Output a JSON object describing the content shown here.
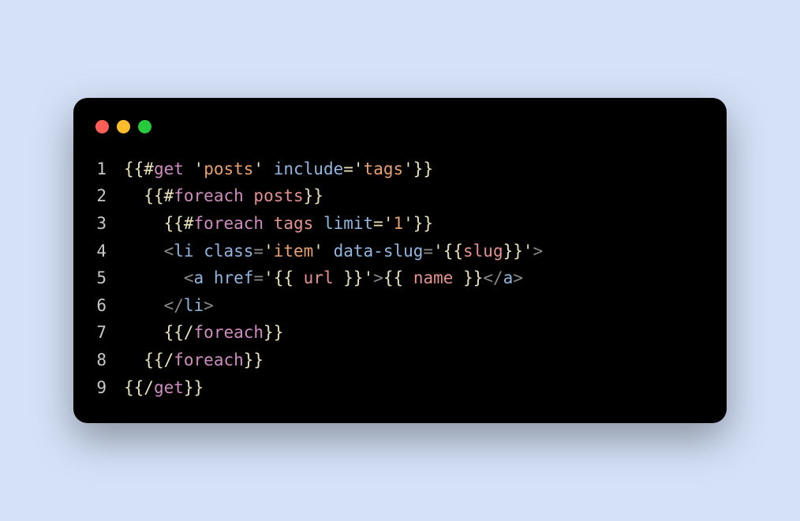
{
  "window": {
    "traffic_lights": [
      "close",
      "minimize",
      "maximize"
    ]
  },
  "code": {
    "lines": [
      {
        "num": "1",
        "indent": 0,
        "tokens": [
          {
            "c": "t-brace",
            "t": "{{"
          },
          {
            "c": "t-brace",
            "t": "#"
          },
          {
            "c": "t-helper",
            "t": "get"
          },
          {
            "c": "t-plain",
            "t": " "
          },
          {
            "c": "t-quote",
            "t": "'"
          },
          {
            "c": "t-string",
            "t": "posts"
          },
          {
            "c": "t-quote",
            "t": "'"
          },
          {
            "c": "t-plain",
            "t": " "
          },
          {
            "c": "t-attr",
            "t": "include"
          },
          {
            "c": "t-brace",
            "t": "="
          },
          {
            "c": "t-quote",
            "t": "'"
          },
          {
            "c": "t-string",
            "t": "tags"
          },
          {
            "c": "t-quote",
            "t": "'"
          },
          {
            "c": "t-brace",
            "t": "}}"
          }
        ]
      },
      {
        "num": "2",
        "indent": 1,
        "tokens": [
          {
            "c": "t-brace",
            "t": "{{"
          },
          {
            "c": "t-brace",
            "t": "#"
          },
          {
            "c": "t-helper",
            "t": "foreach"
          },
          {
            "c": "t-plain",
            "t": " "
          },
          {
            "c": "t-var",
            "t": "posts"
          },
          {
            "c": "t-brace",
            "t": "}}"
          }
        ]
      },
      {
        "num": "3",
        "indent": 2,
        "tokens": [
          {
            "c": "t-brace",
            "t": "{{"
          },
          {
            "c": "t-brace",
            "t": "#"
          },
          {
            "c": "t-helper",
            "t": "foreach"
          },
          {
            "c": "t-plain",
            "t": " "
          },
          {
            "c": "t-var",
            "t": "tags"
          },
          {
            "c": "t-plain",
            "t": " "
          },
          {
            "c": "t-attr",
            "t": "limit"
          },
          {
            "c": "t-brace",
            "t": "="
          },
          {
            "c": "t-quote",
            "t": "'"
          },
          {
            "c": "t-string",
            "t": "1"
          },
          {
            "c": "t-quote",
            "t": "'"
          },
          {
            "c": "t-brace",
            "t": "}}"
          }
        ]
      },
      {
        "num": "4",
        "indent": 2,
        "tokens": [
          {
            "c": "t-punct",
            "t": "<"
          },
          {
            "c": "t-tag",
            "t": "li"
          },
          {
            "c": "t-plain",
            "t": " "
          },
          {
            "c": "t-attr",
            "t": "class"
          },
          {
            "c": "t-eq",
            "t": "="
          },
          {
            "c": "t-quote",
            "t": "'"
          },
          {
            "c": "t-string",
            "t": "item"
          },
          {
            "c": "t-quote",
            "t": "'"
          },
          {
            "c": "t-plain",
            "t": " "
          },
          {
            "c": "t-attr",
            "t": "data-slug"
          },
          {
            "c": "t-eq",
            "t": "="
          },
          {
            "c": "t-quote",
            "t": "'"
          },
          {
            "c": "t-brace",
            "t": "{{"
          },
          {
            "c": "t-var",
            "t": "slug"
          },
          {
            "c": "t-brace",
            "t": "}}"
          },
          {
            "c": "t-quote",
            "t": "'"
          },
          {
            "c": "t-punct",
            "t": ">"
          }
        ]
      },
      {
        "num": "5",
        "indent": 3,
        "tokens": [
          {
            "c": "t-punct",
            "t": "<"
          },
          {
            "c": "t-tag",
            "t": "a"
          },
          {
            "c": "t-plain",
            "t": " "
          },
          {
            "c": "t-attr",
            "t": "href"
          },
          {
            "c": "t-eq",
            "t": "="
          },
          {
            "c": "t-quote",
            "t": "'"
          },
          {
            "c": "t-brace",
            "t": "{{"
          },
          {
            "c": "t-plain",
            "t": " "
          },
          {
            "c": "t-var",
            "t": "url"
          },
          {
            "c": "t-plain",
            "t": " "
          },
          {
            "c": "t-brace",
            "t": "}}"
          },
          {
            "c": "t-quote",
            "t": "'"
          },
          {
            "c": "t-punct",
            "t": ">"
          },
          {
            "c": "t-brace",
            "t": "{{"
          },
          {
            "c": "t-plain",
            "t": " "
          },
          {
            "c": "t-var",
            "t": "name"
          },
          {
            "c": "t-plain",
            "t": " "
          },
          {
            "c": "t-brace",
            "t": "}}"
          },
          {
            "c": "t-punct",
            "t": "</"
          },
          {
            "c": "t-tag",
            "t": "a"
          },
          {
            "c": "t-punct",
            "t": ">"
          }
        ]
      },
      {
        "num": "6",
        "indent": 2,
        "tokens": [
          {
            "c": "t-punct",
            "t": "</"
          },
          {
            "c": "t-tag",
            "t": "li"
          },
          {
            "c": "t-punct",
            "t": ">"
          }
        ]
      },
      {
        "num": "7",
        "indent": 2,
        "tokens": [
          {
            "c": "t-brace",
            "t": "{{"
          },
          {
            "c": "t-brace",
            "t": "/"
          },
          {
            "c": "t-helper",
            "t": "foreach"
          },
          {
            "c": "t-brace",
            "t": "}}"
          }
        ]
      },
      {
        "num": "8",
        "indent": 1,
        "tokens": [
          {
            "c": "t-brace",
            "t": "{{"
          },
          {
            "c": "t-brace",
            "t": "/"
          },
          {
            "c": "t-helper",
            "t": "foreach"
          },
          {
            "c": "t-brace",
            "t": "}}"
          }
        ]
      },
      {
        "num": "9",
        "indent": 0,
        "tokens": [
          {
            "c": "t-brace",
            "t": "{{"
          },
          {
            "c": "t-brace",
            "t": "/"
          },
          {
            "c": "t-helper",
            "t": "get"
          },
          {
            "c": "t-brace",
            "t": "}}"
          }
        ]
      }
    ]
  }
}
